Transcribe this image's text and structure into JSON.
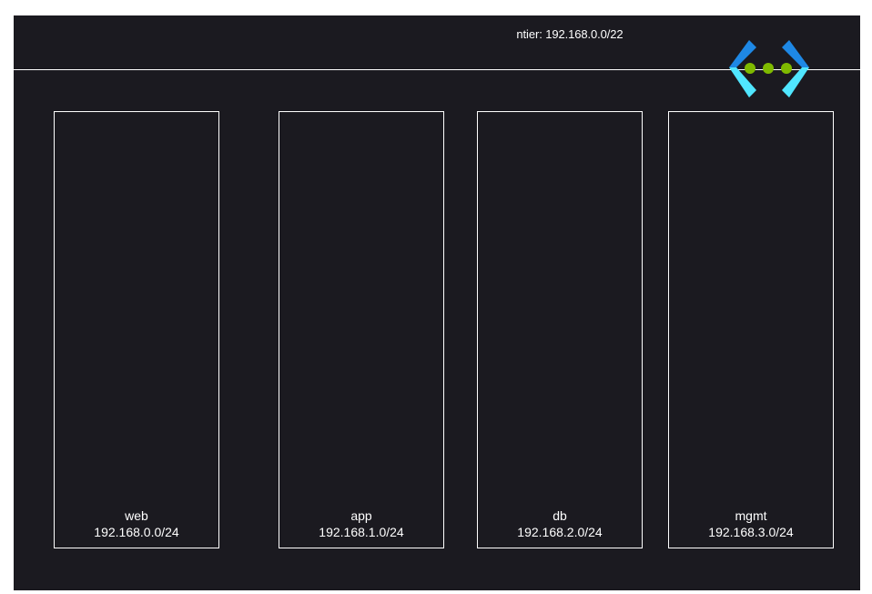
{
  "vnet": {
    "name_cidr": "ntier: 192.168.0.0/22",
    "icon": "virtual-network-icon"
  },
  "subnets": [
    {
      "name": "web",
      "cidr": "192.168.0.0/24"
    },
    {
      "name": "app",
      "cidr": "192.168.1.0/24"
    },
    {
      "name": "db",
      "cidr": "192.168.2.0/24"
    },
    {
      "name": "mgmt",
      "cidr": "192.168.3.0/24"
    }
  ],
  "colors": {
    "background": "#1b1a20",
    "border": "#ffffff",
    "icon_bracket_dark": "#1e88e5",
    "icon_bracket_light": "#50e6ff",
    "icon_dot": "#7fba00"
  }
}
